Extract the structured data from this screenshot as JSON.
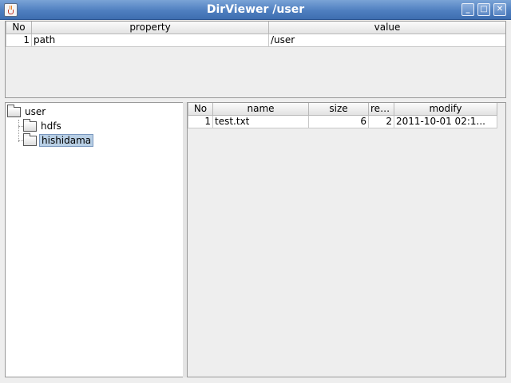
{
  "window": {
    "title": "DirViewer /user",
    "minimize_label": "_",
    "maximize_label": "□",
    "close_label": "✕"
  },
  "properties": {
    "columns": [
      "No",
      "property",
      "value"
    ],
    "rows": [
      {
        "no": "1",
        "property": "path",
        "value": "/user"
      }
    ]
  },
  "tree": {
    "root": "user",
    "children": [
      "hdfs",
      "hishidama"
    ],
    "selected": "hishidama"
  },
  "files": {
    "columns": [
      "No",
      "name",
      "size",
      "rep...",
      "modify"
    ],
    "rows": [
      {
        "no": "1",
        "name": "test.txt",
        "size": "6",
        "rep": "2",
        "modify": "2011-10-01 02:1..."
      }
    ]
  }
}
